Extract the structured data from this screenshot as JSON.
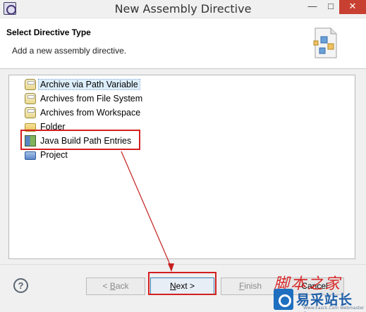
{
  "window": {
    "title": "New Assembly Directive",
    "close_glyph": "✕",
    "minimize_glyph": "—",
    "maximize_glyph": "□"
  },
  "header": {
    "title": "Select Directive Type",
    "description": "Add a new assembly directive.",
    "icon": "wizard-banner-icon"
  },
  "list": {
    "items": [
      {
        "label": "Archive via Path Variable",
        "icon": "jar-icon",
        "selected": true
      },
      {
        "label": "Archives from File System",
        "icon": "jar-icon",
        "selected": false
      },
      {
        "label": "Archives from Workspace",
        "icon": "jar-icon",
        "selected": false
      },
      {
        "label": "Folder",
        "icon": "folder-icon",
        "selected": false
      },
      {
        "label": "Java Build Path Entries",
        "icon": "build-path-icon",
        "selected": false
      },
      {
        "label": "Project",
        "icon": "project-icon",
        "selected": false
      }
    ]
  },
  "footer": {
    "back": {
      "prefix": "< ",
      "mnemonic": "B",
      "rest": "ack",
      "enabled": false
    },
    "next": {
      "mnemonic": "N",
      "rest": "ext >",
      "enabled": true
    },
    "finish": {
      "mnemonic": "F",
      "rest": "inish",
      "enabled": false
    },
    "cancel": {
      "label": "Cancel",
      "enabled": true
    }
  },
  "watermark": {
    "top": "脚本之家",
    "logo_text": "易采站长站",
    "sub": "Www.Easck.Com  Webmaster"
  },
  "annotations": {
    "highlight_color": "#d41f1f"
  }
}
